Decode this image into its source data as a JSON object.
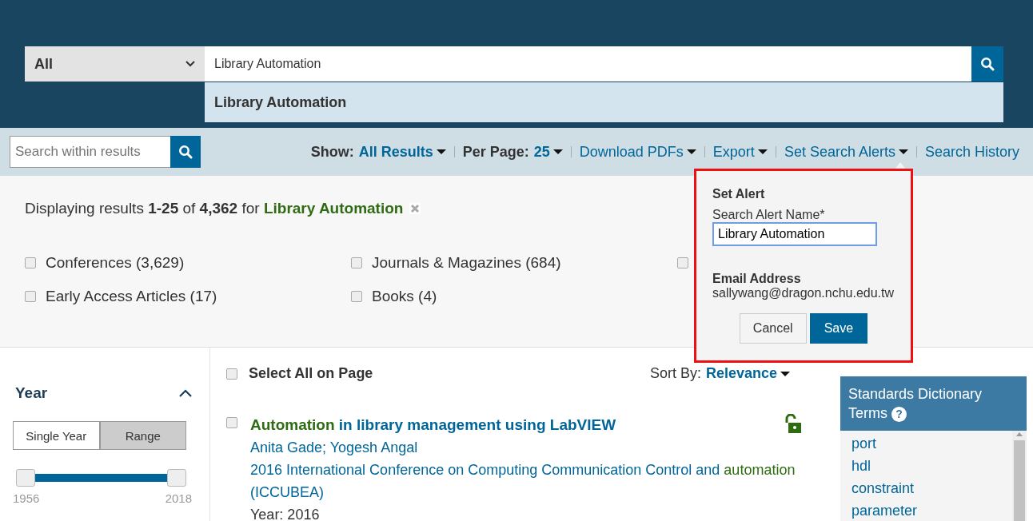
{
  "search": {
    "scope": "All",
    "query": "Library Automation",
    "suggestion": "Library Automation"
  },
  "toolbar": {
    "within_placeholder": "Search within results",
    "show_label": "Show:",
    "show_value": "All Results",
    "per_page_label": "Per Page:",
    "per_page_value": "25",
    "links": [
      {
        "label": "Download PDFs",
        "dropdown": true
      },
      {
        "label": "Export",
        "dropdown": true
      },
      {
        "label": "Set Search Alerts",
        "dropdown": true
      },
      {
        "label": "Search History",
        "dropdown": false
      }
    ]
  },
  "summary": {
    "prefix": "Displaying results ",
    "range": "1-25",
    "of": " of ",
    "total": "4,362",
    "for": " for ",
    "query": "Library Automation"
  },
  "filters": [
    {
      "label": "Conferences (3,629)",
      "checked": false
    },
    {
      "label": "Journals & Magazines (684)",
      "checked": false
    },
    {
      "checked": false
    },
    {
      "label": "Early Access Articles (17)",
      "checked": false
    },
    {
      "label": "Books (4)",
      "checked": false
    }
  ],
  "alert_popup": {
    "title": "Set Alert",
    "name_label": "Search Alert Name*",
    "name_value": "Library Automation",
    "email_label": "Email Address",
    "email": "sallywang@dragon.nchu.edu.tw",
    "cancel": "Cancel",
    "save": "Save"
  },
  "year_filter": {
    "title": "Year",
    "expanded": true,
    "modes": [
      {
        "label": "Single Year",
        "selected": false
      },
      {
        "label": "Range",
        "selected": true
      }
    ],
    "min": "1956",
    "max": "2018"
  },
  "results": {
    "select_all": "Select All on Page",
    "select_all_checked": false,
    "sort_label": "Sort By:",
    "sort_value": "Relevance",
    "items": [
      {
        "checked": false,
        "title": [
          {
            "text": "Automation",
            "highlight": true
          },
          {
            "text": " in library management using LabVIEW",
            "highlight": false
          }
        ],
        "authors": "Anita Gade; Yogesh Angal",
        "venue": [
          {
            "text": "2016 International Conference on Computing Communication Control and ",
            "highlight": false
          },
          {
            "text": "automation",
            "highlight": true
          },
          {
            "text": " (ICCUBEA)",
            "highlight": false
          }
        ],
        "year": "Year: 2016",
        "open_access": true
      }
    ]
  },
  "dictionary": {
    "title": "Standards Dictionary Terms",
    "help": "?",
    "terms": [
      "port",
      "hdl",
      "constraint",
      "parameter"
    ]
  }
}
